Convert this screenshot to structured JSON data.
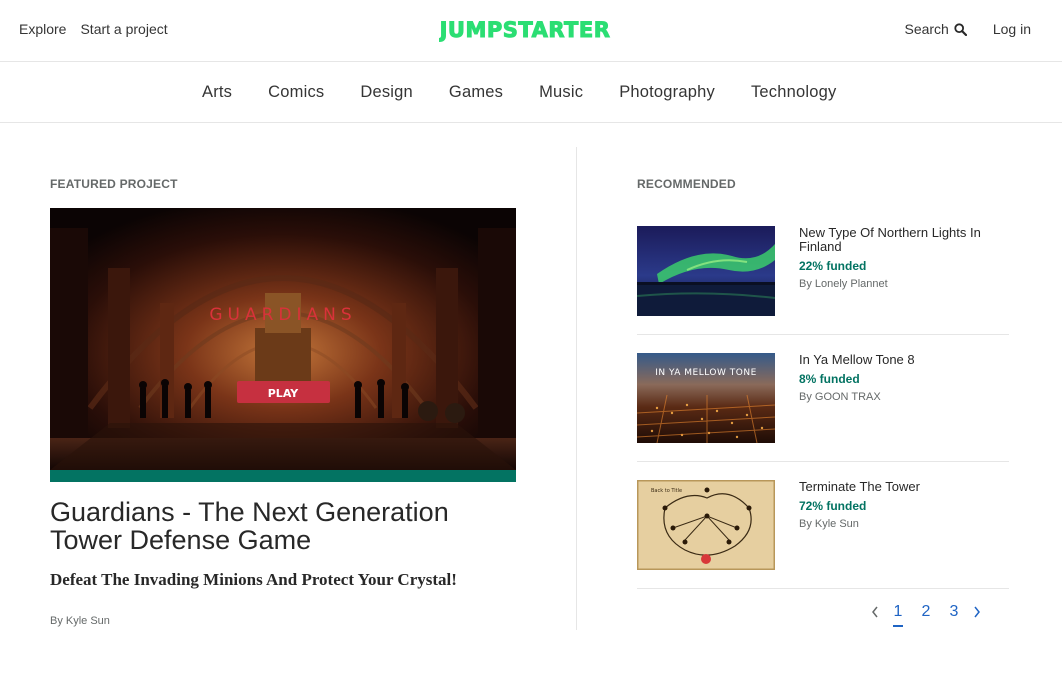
{
  "header": {
    "explore": "Explore",
    "start_project": "Start a project",
    "logo_text": "JUMPSTARTER",
    "search_label": "Search",
    "login": "Log in"
  },
  "categories": [
    "Arts",
    "Comics",
    "Design",
    "Games",
    "Music",
    "Photography",
    "Technology"
  ],
  "featured": {
    "section_label": "FEATURED PROJECT",
    "image_text": "GUARDIANS",
    "play_text": "PLAY",
    "title": "Guardians - The Next Generation Tower Defense Game",
    "blurb": "Defeat The Invading Minions And Protect Your Crystal!",
    "by": "By Kyle Sun",
    "progress_fraction": 1.0
  },
  "recommended": {
    "section_label": "RECOMMENDED",
    "items": [
      {
        "title": "New Type Of Northern Lights In Finland",
        "funded": "22% funded",
        "by": "By Lonely Plannet"
      },
      {
        "title": "In Ya Mellow Tone 8",
        "funded": "8% funded",
        "by": "By GOON TRAX",
        "image_text": "IN YA MELLOW TONE"
      },
      {
        "title": "Terminate The Tower",
        "funded": "72% funded",
        "by": "By Kyle Sun",
        "image_text": "Back to Title"
      }
    ]
  },
  "pagination": {
    "pages": [
      "1",
      "2",
      "3"
    ],
    "current": "1"
  },
  "colors": {
    "brand": "#2bde73",
    "funded": "#037362",
    "link": "#1f64c4"
  },
  "icons": {
    "search": "search-icon",
    "prev": "chevron-left-icon",
    "next": "chevron-right-icon"
  }
}
